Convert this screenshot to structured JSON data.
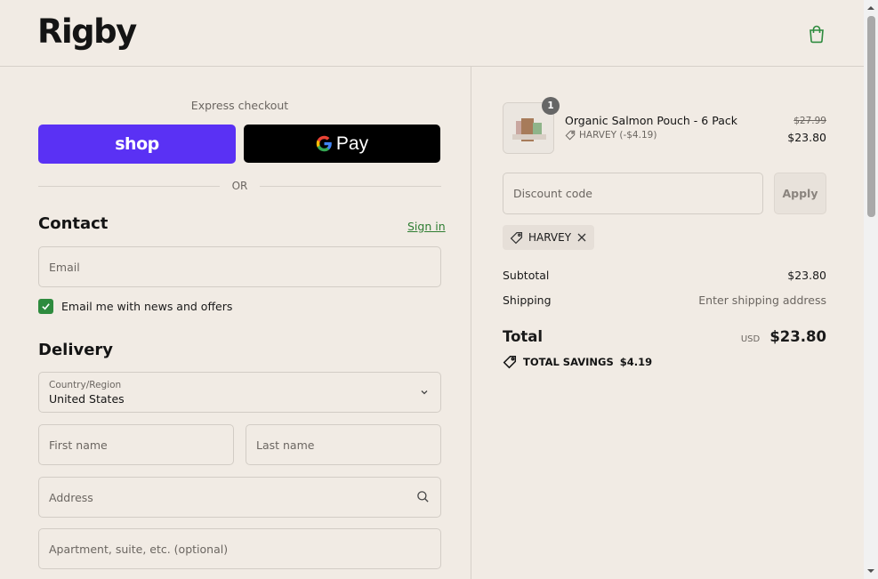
{
  "brand": {
    "logo_text": "Rigby",
    "accent": "#2e8b3e",
    "shop_purple": "#5a31f4"
  },
  "header": {
    "cart_icon": "shopping-bag-icon"
  },
  "express": {
    "title": "Express checkout",
    "shop_label": "shop",
    "gpay_label": "Pay",
    "or_label": "OR"
  },
  "contact": {
    "title": "Contact",
    "signin_label": "Sign in",
    "email_placeholder": "Email",
    "newsletter_label": "Email me with news and offers",
    "newsletter_checked": true
  },
  "delivery": {
    "title": "Delivery",
    "country_label": "Country/Region",
    "country_value": "United States",
    "first_name_placeholder": "First name",
    "last_name_placeholder": "Last name",
    "address_placeholder": "Address",
    "apartment_placeholder": "Apartment, suite, etc. (optional)"
  },
  "order": {
    "item": {
      "quantity": "1",
      "name": "Organic Salmon Pouch - 6 Pack",
      "discount_note": "HARVEY (-$4.19)",
      "original_price": "$27.99",
      "price": "$23.80"
    },
    "discount_placeholder": "Discount code",
    "apply_label": "Apply",
    "applied_code": "HARVEY",
    "subtotal_label": "Subtotal",
    "subtotal_value": "$23.80",
    "shipping_label": "Shipping",
    "shipping_value": "Enter shipping address",
    "total_label": "Total",
    "currency": "USD",
    "total_value": "$23.80",
    "savings_label": "TOTAL SAVINGS",
    "savings_value": "$4.19"
  }
}
